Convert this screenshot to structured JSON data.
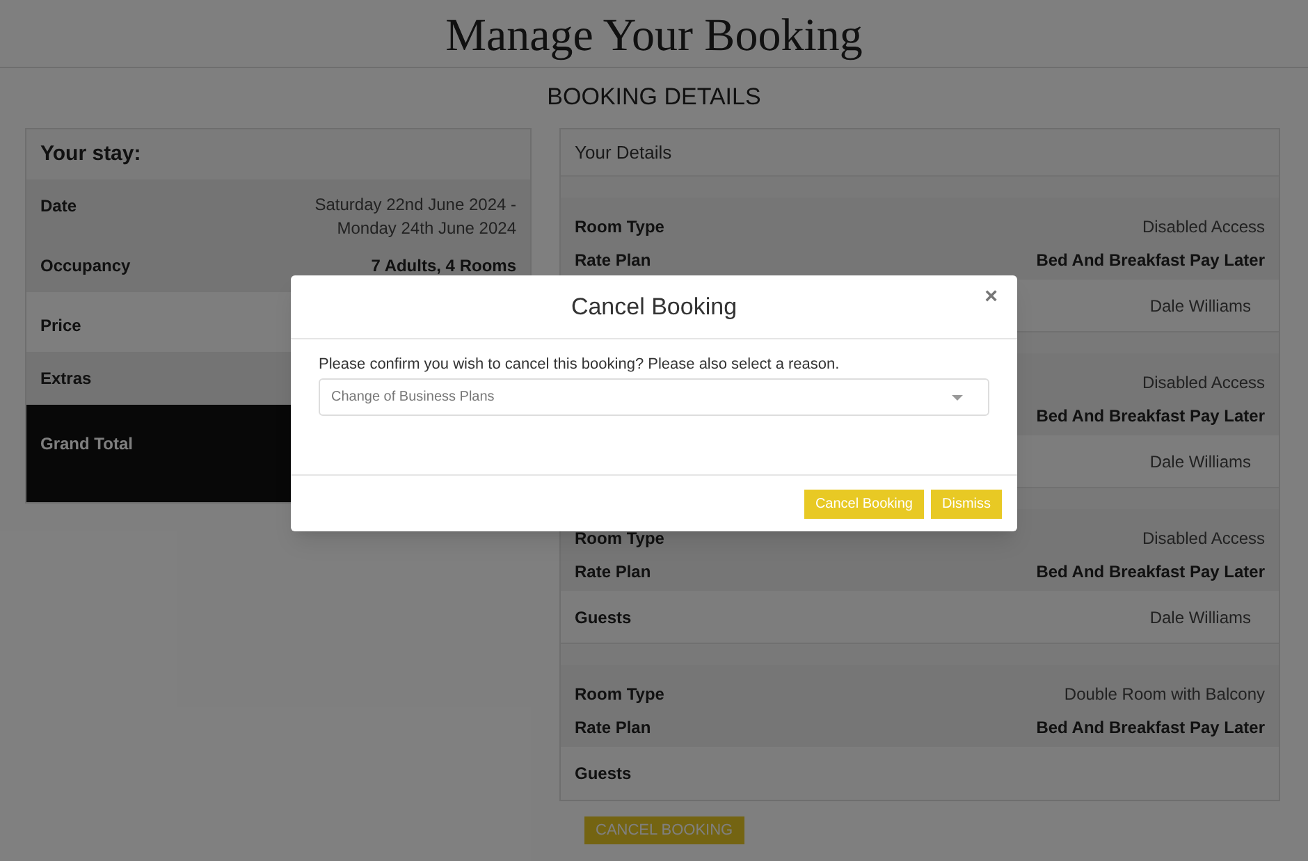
{
  "page_title": "Manage Your Booking",
  "section_title": "BOOKING DETAILS",
  "stay": {
    "title": "Your stay:",
    "groups": [
      [
        {
          "kind": "date",
          "label": "Date",
          "value": "Saturday 22nd June 2024 - Monday 24th June 2024"
        },
        {
          "kind": "occupancy",
          "label": "Occupancy",
          "value": "7 Adults, 4 Rooms"
        }
      ],
      [
        {
          "kind": "price",
          "label": "Price"
        }
      ],
      [
        {
          "kind": "extras",
          "label": "Extras"
        }
      ]
    ],
    "total": {
      "label": "Grand Total"
    }
  },
  "details": {
    "title": "Your Details",
    "rooms": [
      {
        "room_type": {
          "label": "Room Type",
          "value": "Disabled Access"
        },
        "rate_plan": {
          "label": "Rate Plan",
          "value": "Bed And Breakfast Pay Later"
        },
        "guests": {
          "value": "Dale Williams"
        }
      },
      {
        "room_type": {
          "value": "Disabled Access"
        },
        "rate_plan": {
          "value": "Bed And Breakfast Pay Later"
        },
        "guests": {
          "value": "Dale Williams"
        }
      },
      {
        "room_type": {
          "label": "Room Type",
          "value": "Disabled Access"
        },
        "rate_plan": {
          "label": "Rate Plan",
          "value": "Bed And Breakfast Pay Later"
        },
        "guests": {
          "label": "Guests",
          "value": "Dale Williams"
        }
      },
      {
        "room_type": {
          "label": "Room Type",
          "value": "Double Room with Balcony"
        },
        "rate_plan": {
          "label": "Rate Plan",
          "value": "Bed And Breakfast Pay Later"
        },
        "guests": {
          "label": "Guests"
        }
      }
    ]
  },
  "cancel_button": "CANCEL BOOKING",
  "modal": {
    "title": "Cancel Booking",
    "close": "×",
    "message": "Please confirm you wish to cancel this booking? Please also select a reason.",
    "reason_select": {
      "value": "Change of Business Plans"
    },
    "buttons": [
      "Cancel Booking",
      "Dismiss"
    ]
  }
}
